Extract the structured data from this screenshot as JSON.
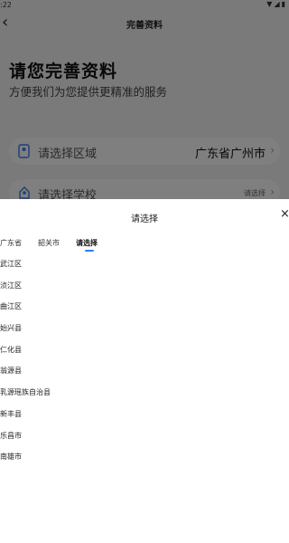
{
  "status_bar": {
    "time": ":22"
  },
  "nav": {
    "title": "完善资料"
  },
  "header": {
    "title": "请您完善资料",
    "subtitle": "方便我们为您提供更精准的服务"
  },
  "fields": {
    "region": {
      "label": "请选择区域",
      "value": "广东省广州市"
    },
    "school": {
      "label": "请选择学校",
      "value": "请选择"
    }
  },
  "sheet": {
    "title": "请选择",
    "close": "×",
    "tabs": [
      "广东省",
      "韶关市",
      "请选择"
    ],
    "active_tab": 2,
    "items": [
      "武江区",
      "浈江区",
      "曲江区",
      "始兴县",
      "仁化县",
      "翁源县",
      "乳源瑶族自治县",
      "新丰县",
      "乐昌市",
      "南雄市"
    ]
  },
  "colors": {
    "accent": "#2f7df6",
    "icon_blue": "#3a7bf0"
  }
}
